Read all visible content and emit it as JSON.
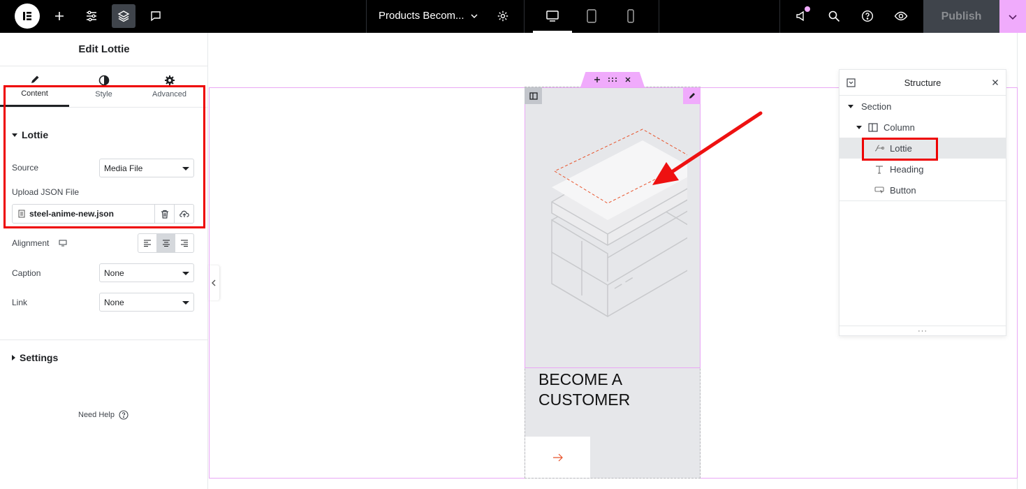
{
  "topbar": {
    "page_title": "Products Becom...",
    "publish_label": "Publish",
    "icons": [
      "elementor-logo-icon",
      "add-element-icon",
      "site-settings-icon",
      "structure-layers-icon",
      "notes-icon",
      "chevron-down-icon",
      "page-settings-icon",
      "desktop-icon",
      "tablet-icon",
      "mobile-icon",
      "whats-new-icon",
      "finder-search-icon",
      "help-icon",
      "preview-eye-icon"
    ]
  },
  "panel": {
    "title": "Edit Lottie",
    "tabs": [
      {
        "label": "Content",
        "icon": "pencil-icon",
        "active": true
      },
      {
        "label": "Style",
        "icon": "half-circle-icon",
        "active": false
      },
      {
        "label": "Advanced",
        "icon": "gear-icon",
        "active": false
      }
    ],
    "lottie_section": {
      "title": "Lottie",
      "source": {
        "label": "Source",
        "value": "Media File"
      },
      "upload": {
        "label": "Upload JSON File",
        "file_name": "steel-anime-new.json"
      },
      "alignment": {
        "label": "Alignment",
        "options": [
          "left",
          "center",
          "right"
        ],
        "selected": "center"
      }
    },
    "caption": {
      "label": "Caption",
      "value": "None"
    },
    "link": {
      "label": "Link",
      "value": "None"
    },
    "settings_title": "Settings",
    "need_help": "Need Help"
  },
  "canvas": {
    "heading_line1": "BECOME A",
    "heading_line2": "CUSTOMER",
    "accent": "#f0abfc",
    "arrow_color": "#ee1111",
    "cta_arrow_color": "#e8532b"
  },
  "structure": {
    "title": "Structure",
    "items": [
      {
        "label": "Section",
        "level": 0,
        "icon": "caret-down-icon"
      },
      {
        "label": "Column",
        "level": 1,
        "icon": "column-icon"
      },
      {
        "label": "Lottie",
        "level": 2,
        "icon": "lottie-icon",
        "selected": true
      },
      {
        "label": "Heading",
        "level": 2,
        "icon": "heading-icon"
      },
      {
        "label": "Button",
        "level": 2,
        "icon": "button-icon"
      }
    ]
  }
}
